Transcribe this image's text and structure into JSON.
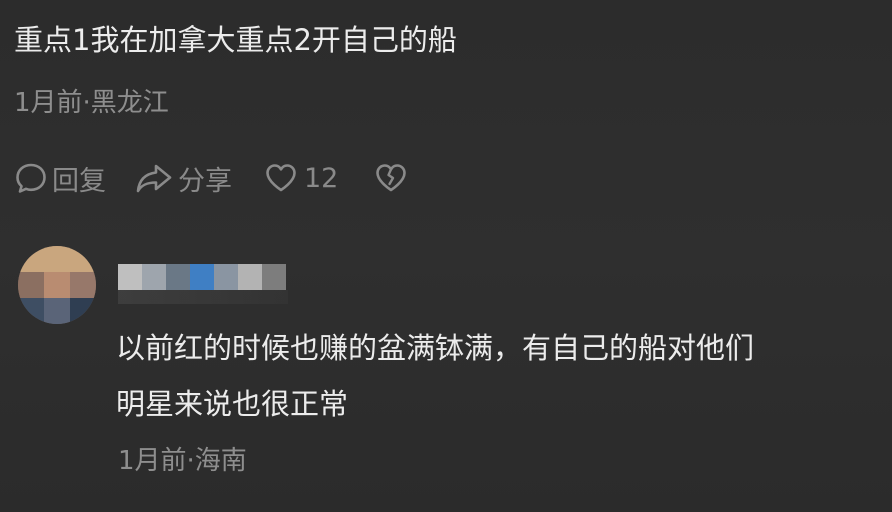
{
  "comment": {
    "text": "重点1我在加拿大重点2开自己的船",
    "meta": "1月前·黑龙江"
  },
  "actions": {
    "reply_label": "回复",
    "share_label": "分享",
    "like_count": "12",
    "icons": [
      "comment-bubble-icon",
      "share-arrow-icon",
      "heart-icon",
      "broken-heart-icon"
    ]
  },
  "reply": {
    "text_lines": [
      "以前红的时候也赚的盆满钵满，有自己的船对他们",
      "明星来说也很正常"
    ],
    "meta": "1月前·海南"
  },
  "colors": {
    "background": "#2d2d2d",
    "primary_text": "#ececec",
    "secondary_text": "#8e8e8e",
    "icon": "#8a8a8a"
  }
}
